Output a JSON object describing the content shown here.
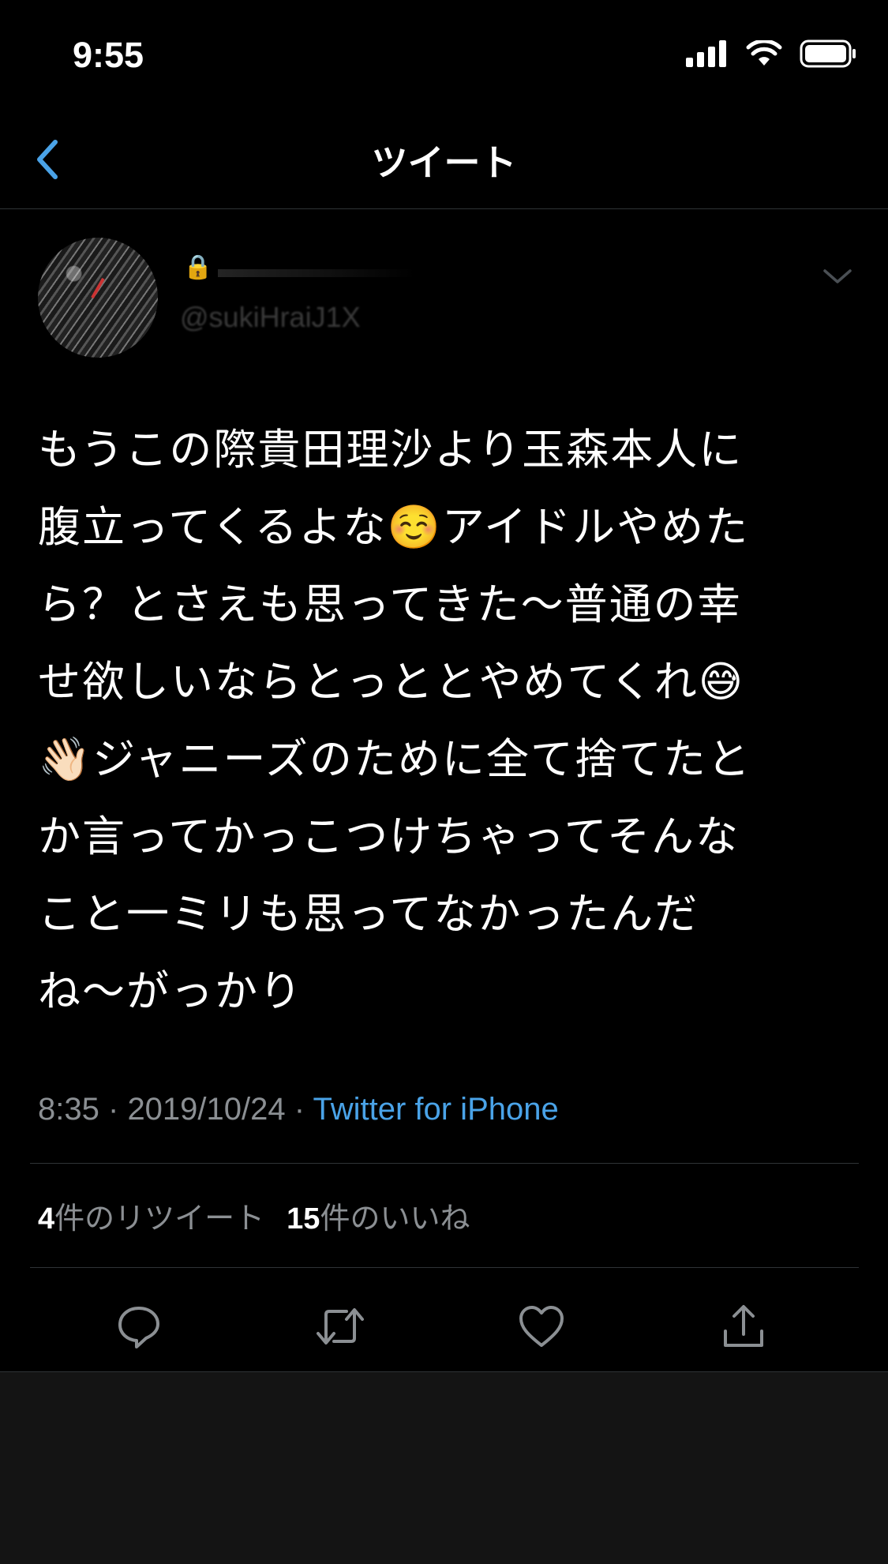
{
  "status_bar": {
    "time": "9:55"
  },
  "nav": {
    "title": "ツイート"
  },
  "tweet": {
    "display_name": "🔒",
    "handle": "@sukiHraiJ1X",
    "text": "もうこの際貴田理沙より玉森本人に\n腹立ってくるよな☺️アイドルやめた\nら？とさえも思ってきた〜普通の幸\nせ欲しいならとっととやめてくれ😅\n👋🏻ジャニーズのために全て捨てたと\nか言ってかっこつけちゃってそんな\nこと一ミリも思ってなかったんだ\nね〜がっかり",
    "time": "8:35",
    "separator": "·",
    "date": "2019/10/24",
    "source": "Twitter for iPhone",
    "retweets_count": "4",
    "retweets_label": "件のリツイート",
    "likes_count": "15",
    "likes_label": "件のいいね"
  },
  "icons": [
    "back-chevron-icon",
    "signal-icon",
    "wifi-icon",
    "battery-icon",
    "chevron-down-icon",
    "reply-icon",
    "retweet-icon",
    "like-icon",
    "share-icon"
  ],
  "colors": {
    "background": "#000000",
    "accent": "#4aa3e8",
    "secondary_text": "#8b8f93"
  }
}
